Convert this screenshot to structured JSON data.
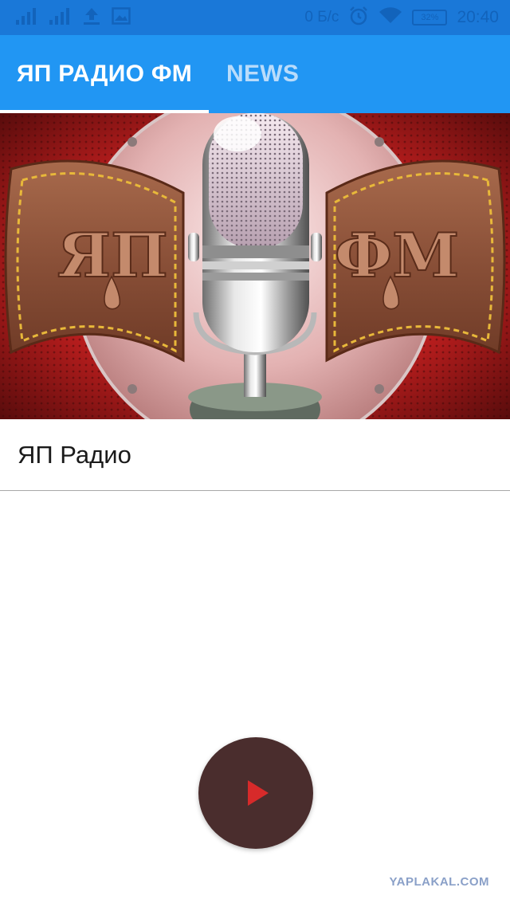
{
  "status_bar": {
    "speed": "0 Б/с",
    "battery": "32%",
    "time": "20:40",
    "icons": [
      "signal-icon",
      "signal-icon",
      "upload-icon",
      "image-icon",
      "alarm-icon",
      "wifi-icon",
      "battery-icon"
    ]
  },
  "tabs": [
    {
      "label": "ЯП РАДИО ФМ",
      "active": true
    },
    {
      "label": "NEWS",
      "active": false
    }
  ],
  "banner": {
    "logo_left": "ЯП",
    "logo_right": "ФМ"
  },
  "station": {
    "name": "ЯП Радио"
  },
  "player": {
    "icon": "play-icon",
    "button_color": "#4a2d2d",
    "icon_color": "#d72a2a"
  },
  "watermark": "YAPLAKAL.COM",
  "colors": {
    "status_bar": "#1a78d8",
    "tab_bar": "#2196f3",
    "tab_active_text": "#ffffff",
    "tab_inactive_text": "#b9dcfb"
  }
}
